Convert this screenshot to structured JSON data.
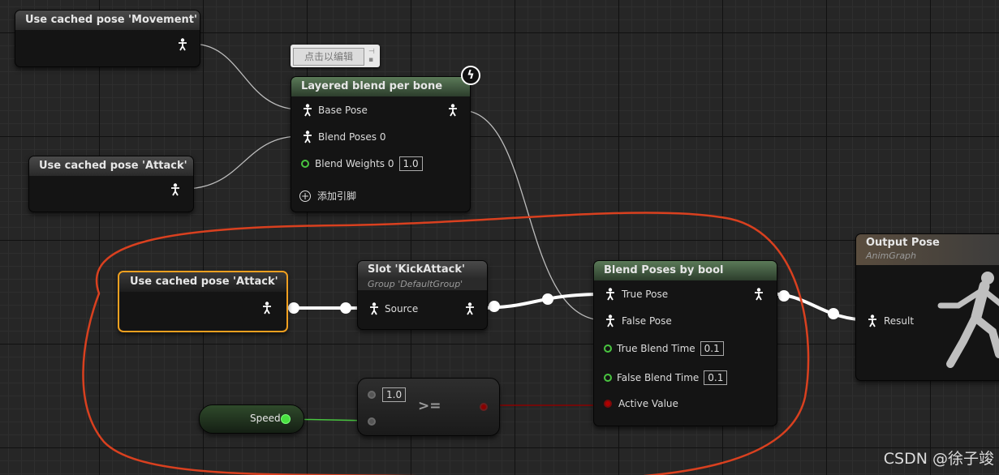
{
  "nodes": {
    "cached_movement": {
      "title": "Use cached pose 'Movement'"
    },
    "cached_attack_top": {
      "title": "Use cached pose 'Attack'"
    },
    "cached_attack_selected": {
      "title": "Use cached pose 'Attack'"
    },
    "layered_blend": {
      "title": "Layered blend per bone",
      "tooltip": "点击以编辑",
      "pins": {
        "base_pose": "Base Pose",
        "blend_poses_0": "Blend Poses 0",
        "blend_weights_0": "Blend Weights 0",
        "blend_weights_0_value": "1.0",
        "add_pin": "添加引脚"
      }
    },
    "slot": {
      "title": "Slot 'KickAttack'",
      "subtitle": "Group 'DefaultGroup'",
      "pins": {
        "source": "Source"
      }
    },
    "blend_bool": {
      "title": "Blend Poses by bool",
      "pins": {
        "true_pose": "True Pose",
        "false_pose": "False Pose",
        "true_blend_time": "True Blend Time",
        "true_blend_time_value": "0.1",
        "false_blend_time": "False Blend Time",
        "false_blend_time_value": "0.1",
        "active_value": "Active Value"
      }
    },
    "compare": {
      "op": ">=",
      "a_value": "1.0"
    },
    "speed": {
      "label": "Speed"
    },
    "output": {
      "title": "Output Pose",
      "subtitle": "AnimGraph",
      "pins": {
        "result": "Result"
      }
    }
  },
  "watermark": "CSDN @徐子竣",
  "colors": {
    "exec_wire": "#ffffff",
    "float_pin": "#49c540",
    "bool_pin": "#b00000",
    "annotation": "#d9401f",
    "selection": "#f0a020"
  }
}
